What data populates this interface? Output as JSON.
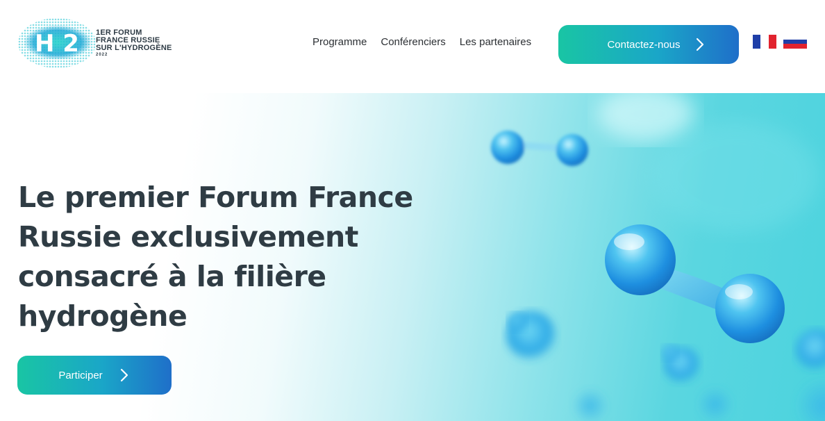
{
  "logo": {
    "mark_text": "H 2",
    "lines": [
      "1ER FORUM",
      "FRANCE RUSSIE",
      "SUR L'HYDROGÈNE"
    ],
    "year": "2022"
  },
  "nav": {
    "items": [
      "Programme",
      "Conférenciers",
      "Les partenaires"
    ]
  },
  "contact_button": {
    "label": "Contactez-nous",
    "icon": "chevron-right-icon"
  },
  "languages": [
    {
      "name": "flag-fr-icon",
      "colors": [
        "#1f3fa8",
        "#ffffff",
        "#e1232e"
      ]
    },
    {
      "name": "flag-ru-icon",
      "colors": [
        "#ffffff",
        "#1f3fa8",
        "#e1232e"
      ]
    }
  ],
  "hero": {
    "title": "Le premier Forum France Russie exclusivement consacré à la filière hydrogène",
    "cta_label": "Participer",
    "cta_icon": "chevron-right-icon"
  },
  "colors": {
    "button_gradient": [
      "#19c5a4",
      "#1aa6c8",
      "#1f6fc9"
    ],
    "text_dark": "#2f3c44",
    "hero_cyan": "#4cd3de"
  }
}
